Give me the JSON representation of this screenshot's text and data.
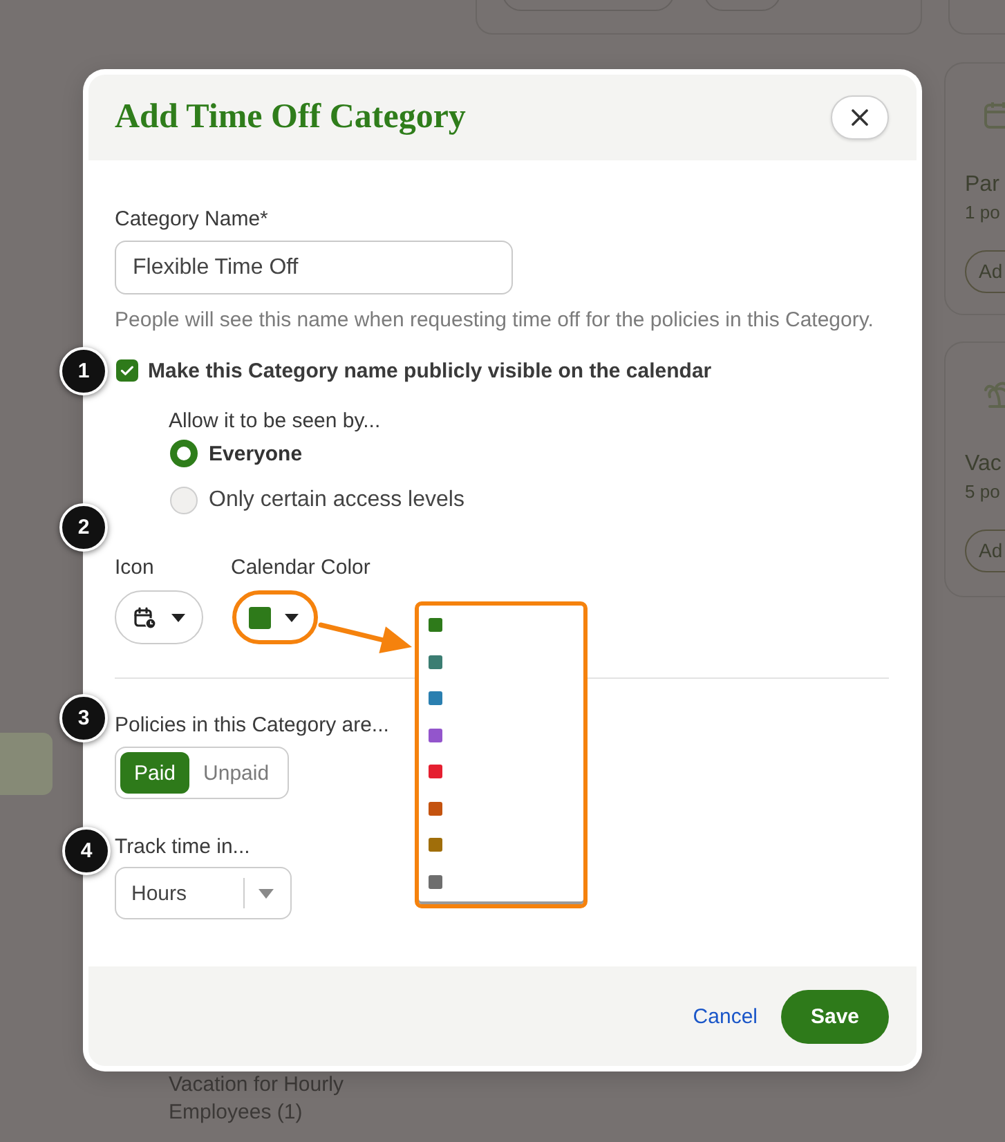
{
  "dialog": {
    "title": "Add Time Off Category",
    "category_name": {
      "label": "Category Name*",
      "value": "Flexible Time Off",
      "help": "People will see this name when requesting time off for the policies in this Category."
    },
    "public_checkbox": {
      "label": "Make this Category name publicly visible on the calendar",
      "checked": true
    },
    "visibility": {
      "label": "Allow it to be seen by...",
      "options": [
        {
          "label": "Everyone",
          "selected": true
        },
        {
          "label": "Only certain access levels",
          "selected": false
        }
      ]
    },
    "icon_field": {
      "label": "Icon"
    },
    "calendar_color": {
      "label": "Calendar Color",
      "color": "#2e7a1a"
    },
    "color_options": [
      {
        "color": "#2e7a1a"
      },
      {
        "color": "#3b7d72"
      },
      {
        "color": "#2a7fb0"
      },
      {
        "color": "#9355cc"
      },
      {
        "color": "#e51f30"
      },
      {
        "color": "#c4530f"
      },
      {
        "color": "#a06e0a"
      },
      {
        "color": "#6e6e6e"
      }
    ],
    "pay_type": {
      "label": "Policies in this Category are...",
      "options": [
        {
          "label": "Paid",
          "selected": true
        },
        {
          "label": "Unpaid",
          "selected": false
        }
      ]
    },
    "track_time": {
      "label": "Track time in...",
      "value": "Hours"
    },
    "buttons": [
      {
        "label": "Cancel",
        "kind": "link"
      },
      {
        "label": "Save",
        "kind": "primary"
      }
    ]
  },
  "callouts": [
    "1",
    "2",
    "3",
    "4"
  ],
  "background": {
    "cards": [
      {
        "title": "Par",
        "subtitle": "1 po",
        "button": "Ad"
      },
      {
        "title": "Vac",
        "subtitle": "5 po",
        "button": "Ad"
      }
    ],
    "list_item": "Vacation for Hourly Employees (1)"
  }
}
